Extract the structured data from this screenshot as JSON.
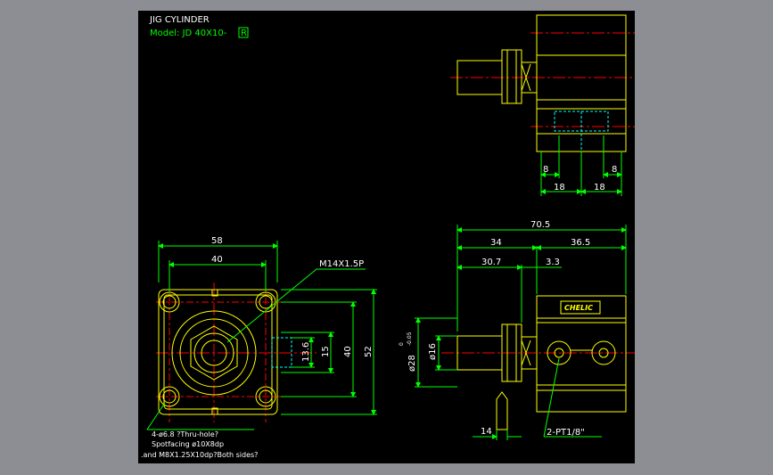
{
  "title_block": {
    "title": "JIG CYLINDER",
    "model": "Model: JD 40X10-",
    "model_box": "R"
  },
  "brand": "CHELIC",
  "front_view": {
    "dim_width_outer": "58",
    "dim_width_inner": "40",
    "thread_callout": "M14X1.5P",
    "dim_port_13_6": "13.6",
    "dim_port_15": "15",
    "dim_height_inner": "40",
    "dim_height_outer": "52",
    "note_line1": "4-ø6.8 ?Thru-hole?",
    "note_line2": "Spotfacing  ø10X8dp",
    "note_line3": ".and M8X1.25X10dp?Both sides?"
  },
  "side_view": {
    "dim_total": "70.5",
    "dim_34": "34",
    "dim_36_5": "36.5",
    "dim_30_7": "30.7",
    "dim_3_3": "3.3",
    "dim_rod": "ø16",
    "dim_body": "ø28",
    "tol_upper": "0",
    "tol_lower": "-0.05",
    "dim_14": "14",
    "port_callout": "2-PT1/8\""
  },
  "top_view": {
    "dim_8_left": "8",
    "dim_8_right": "8",
    "dim_18_left": "18",
    "dim_18_right": "18"
  },
  "colors": {
    "background": "#8c8e93",
    "drawing_bg": "#000000",
    "outline": "#ffff00",
    "dimension": "#00ff00",
    "centerline": "#ff0000",
    "hidden": "#00ffff",
    "text": "#ffffff"
  }
}
